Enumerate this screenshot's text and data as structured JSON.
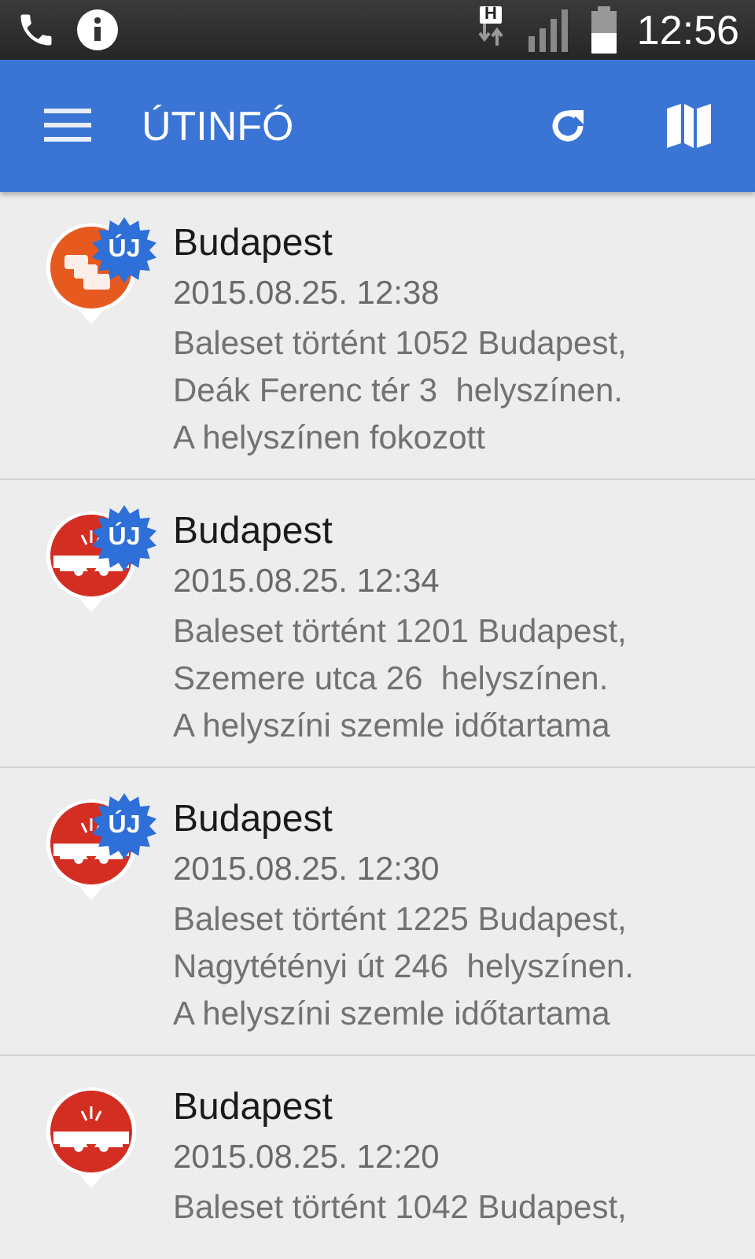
{
  "status_bar": {
    "network_type": "H",
    "time": "12:56"
  },
  "app_bar": {
    "title": "ÚTINFÓ"
  },
  "items": [
    {
      "kind": "jam",
      "badge": "ÚJ",
      "title": "Budapest",
      "date": "2015.08.25. 12:38",
      "body": "Baleset történt 1052 Budapest,\nDeák Ferenc tér 3  helyszínen.\nA helyszínen fokozott"
    },
    {
      "kind": "crash",
      "badge": "ÚJ",
      "title": "Budapest",
      "date": "2015.08.25. 12:34",
      "body": "Baleset történt 1201 Budapest,\nSzemere utca 26  helyszínen.\nA helyszíni szemle időtartama"
    },
    {
      "kind": "crash",
      "badge": "ÚJ",
      "title": "Budapest",
      "date": "2015.08.25. 12:30",
      "body": "Baleset történt 1225 Budapest,\nNagytétényi út 246  helyszínen.\nA helyszíni szemle időtartama"
    },
    {
      "kind": "crash",
      "title": "Budapest",
      "date": "2015.08.25. 12:20",
      "body": "Baleset történt 1042 Budapest,"
    }
  ]
}
